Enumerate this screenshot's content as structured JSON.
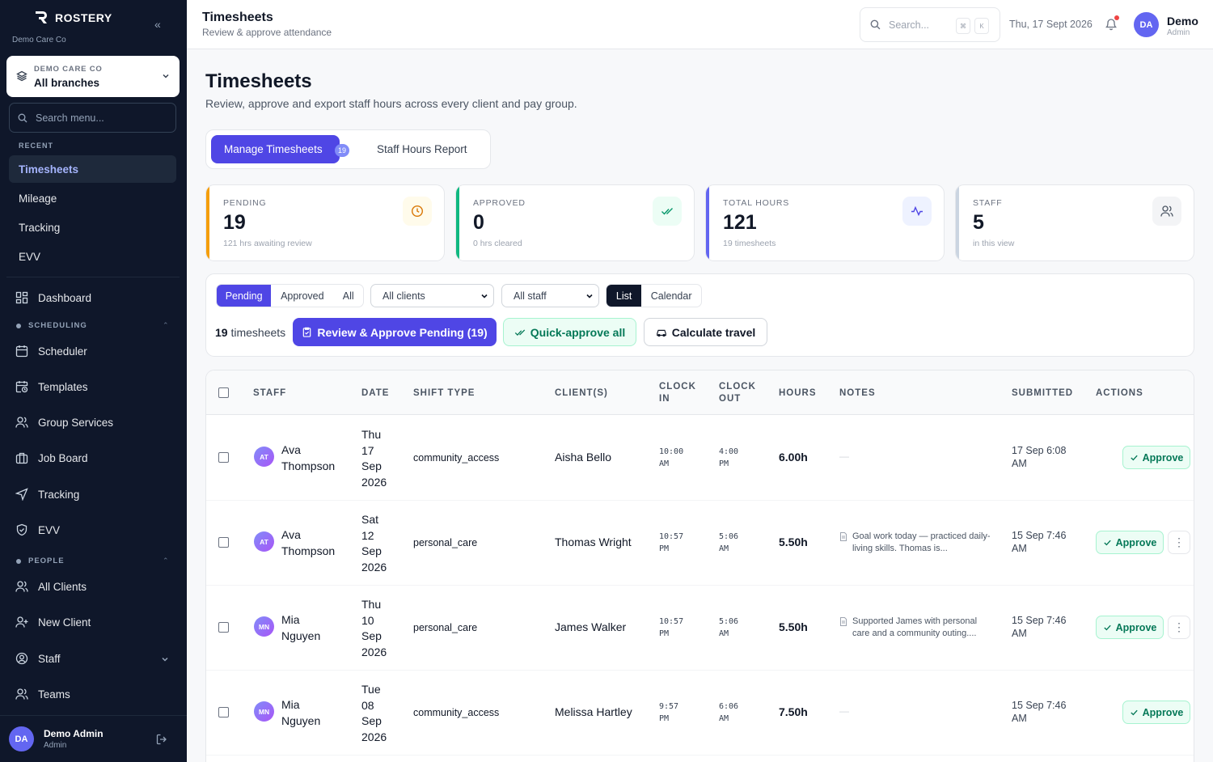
{
  "brand": {
    "name": "ROSTERY",
    "org": "Demo Care Co"
  },
  "branch": {
    "org_label": "DEMO CARE CO",
    "value": "All branches"
  },
  "menu_search": {
    "placeholder": "Search menu..."
  },
  "recent": {
    "label": "RECENT",
    "items": [
      "Timesheets",
      "Mileage",
      "Tracking",
      "EVV"
    ]
  },
  "nav": {
    "dashboard": "Dashboard",
    "scheduling_label": "SCHEDULING",
    "scheduling": [
      "Scheduler",
      "Templates",
      "Group Services",
      "Job Board",
      "Tracking",
      "EVV"
    ],
    "people_label": "PEOPLE",
    "people": [
      "All Clients",
      "New Client",
      "Staff",
      "Teams"
    ]
  },
  "user": {
    "initials": "DA",
    "name": "Demo Admin",
    "role": "Admin",
    "short_name": "Demo"
  },
  "topbar": {
    "title": "Timesheets",
    "subtitle": "Review & approve attendance",
    "search_placeholder": "Search...",
    "kbd": [
      "⌘",
      "K"
    ],
    "date": "Thu, 17 Sept 2026"
  },
  "page": {
    "title": "Timesheets",
    "subtitle": "Review, approve and export staff hours across every client and pay group."
  },
  "tabs": {
    "manage": "Manage Timesheets",
    "manage_badge": "19",
    "report": "Staff Hours Report"
  },
  "stats": [
    {
      "label": "PENDING",
      "value": "19",
      "desc": "121 hrs awaiting review",
      "color": "#f59e0b",
      "icon": "clock-icon"
    },
    {
      "label": "APPROVED",
      "value": "0",
      "desc": "0 hrs cleared",
      "color": "#10b981",
      "icon": "double-check-icon"
    },
    {
      "label": "TOTAL HOURS",
      "value": "121",
      "desc": "19 timesheets",
      "color": "#6366f1",
      "icon": "activity-icon"
    },
    {
      "label": "STAFF",
      "value": "5",
      "desc": "in this view",
      "color": "#94a3b8",
      "icon": "users-icon"
    }
  ],
  "filters": {
    "status": [
      "Pending",
      "Approved",
      "All"
    ],
    "clients": "All clients",
    "staff": "All staff",
    "view": [
      "List",
      "Calendar"
    ],
    "count": "19",
    "count_label": "timesheets",
    "review_btn": "Review & Approve Pending (19)",
    "quick_btn": "Quick-approve all",
    "travel_btn": "Calculate travel"
  },
  "table": {
    "headers": {
      "staff": "STAFF",
      "date": "DATE",
      "shift": "SHIFT TYPE",
      "clients": "CLIENT(S)",
      "clock_in": [
        "CLOCK",
        "IN"
      ],
      "clock_out": [
        "CLOCK",
        "OUT"
      ],
      "hours": "HOURS",
      "notes": "NOTES",
      "submitted": "SUBMITTED",
      "actions": "ACTIONS"
    },
    "approve_label": "Approve",
    "rows": [
      {
        "initials": "AT",
        "first": "Ava",
        "last": "Thompson",
        "date": [
          "Thu",
          "17",
          "Sep",
          "2026"
        ],
        "shift": "community_access",
        "client": "Aisha Bello",
        "in": [
          "10:00",
          "AM"
        ],
        "out": [
          "4:00",
          "PM"
        ],
        "hours": "6.00h",
        "note": "—",
        "submitted": [
          "17 Sep 6:08",
          "AM"
        ]
      },
      {
        "initials": "AT",
        "first": "Ava",
        "last": "Thompson",
        "date": [
          "Sat",
          "12",
          "Sep",
          "2026"
        ],
        "shift": "personal_care",
        "client": "Thomas Wright",
        "in": [
          "10:57",
          "PM"
        ],
        "out": [
          "5:06",
          "AM"
        ],
        "hours": "5.50h",
        "note": "Goal work today — practiced daily-living skills. Thomas is...",
        "submitted": [
          "15 Sep 7:46",
          "AM"
        ]
      },
      {
        "initials": "MN",
        "first": "Mia",
        "last": "Nguyen",
        "date": [
          "Thu",
          "10",
          "Sep",
          "2026"
        ],
        "shift": "personal_care",
        "client": "James Walker",
        "in": [
          "10:57",
          "PM"
        ],
        "out": [
          "5:06",
          "AM"
        ],
        "hours": "5.50h",
        "note": "Supported James with personal care and a community outing....",
        "submitted": [
          "15 Sep 7:46",
          "AM"
        ]
      },
      {
        "initials": "MN",
        "first": "Mia",
        "last": "Nguyen",
        "date": [
          "Tue",
          "08",
          "Sep",
          "2026"
        ],
        "shift": "community_access",
        "client": "Melissa Hartley",
        "in": [
          "9:57",
          "PM"
        ],
        "out": [
          "6:06",
          "AM"
        ],
        "hours": "7.50h",
        "note": "—",
        "submitted": [
          "15 Sep 7:46",
          "AM"
        ]
      }
    ]
  }
}
